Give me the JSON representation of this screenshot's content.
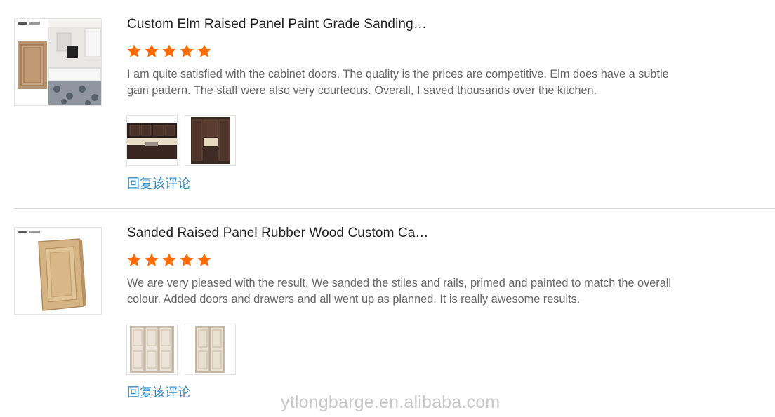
{
  "reviews": [
    {
      "title": "Custom Elm Raised Panel Paint Grade Sanding…",
      "rating": 5,
      "text_lines": [
        "I am quite satisfied with the cabinet doors. The quality is the prices are competitive. Elm does have a subtle",
        "gain pattern. The staff were also very courteous. Overall, I saved thousands over the kitchen."
      ],
      "reply_label": "回复该评论"
    },
    {
      "title": "Sanded Raised Panel Rubber Wood Custom Ca…",
      "rating": 5,
      "text_lines": [
        "We are very pleased with the result. We sanded the stiles and rails, primed and painted to match the overall",
        "colour. Added doors and drawers and all went up as planned. It is really awesome results."
      ],
      "reply_label": "回复该评论"
    }
  ],
  "watermark": "ytlongbarge.en.alibaba.com",
  "colors": {
    "star": "#ff6a00",
    "link": "#3a8cc5",
    "title": "#222222",
    "body_text": "#666666"
  }
}
